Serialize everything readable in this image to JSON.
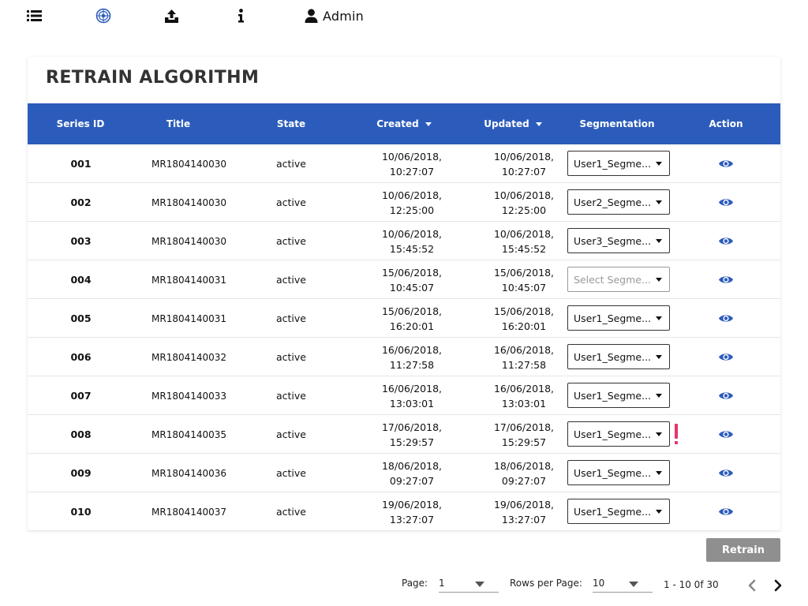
{
  "topbar": {
    "icons": [
      "list-icon",
      "globe-icon",
      "upload-icon",
      "info-icon",
      "user-icon"
    ],
    "user_label": "Admin"
  },
  "page": {
    "title": "RETRAIN ALGORITHM"
  },
  "table": {
    "columns": {
      "series_id": "Series ID",
      "title": "Title",
      "state": "State",
      "created": "Created",
      "updated": "Updated",
      "segmentation": "Segmentation",
      "action": "Action"
    },
    "rows": [
      {
        "id": "001",
        "title": "MR1804140030",
        "state": "active",
        "created_date": "10/06/2018,",
        "created_time": "10:27:07",
        "updated_date": "10/06/2018,",
        "updated_time": "10:27:07",
        "segmentation": "User1_Segme..."
      },
      {
        "id": "002",
        "title": "MR1804140030",
        "state": "active",
        "created_date": "10/06/2018,",
        "created_time": "12:25:00",
        "updated_date": "10/06/2018,",
        "updated_time": "12:25:00",
        "segmentation": "User2_Segme..."
      },
      {
        "id": "003",
        "title": "MR1804140030",
        "state": "active",
        "created_date": "10/06/2018,",
        "created_time": "15:45:52",
        "updated_date": "10/06/2018,",
        "updated_time": "15:45:52",
        "segmentation": "User3_Segme..."
      },
      {
        "id": "004",
        "title": "MR1804140031",
        "state": "active",
        "created_date": "15/06/2018,",
        "created_time": "10:45:07",
        "updated_date": "15/06/2018,",
        "updated_time": "10:45:07",
        "segmentation": "Select Segme..."
      },
      {
        "id": "005",
        "title": "MR1804140031",
        "state": "active",
        "created_date": "15/06/2018,",
        "created_time": "16:20:01",
        "updated_date": "15/06/2018,",
        "updated_time": "16:20:01",
        "segmentation": "User1_Segme..."
      },
      {
        "id": "006",
        "title": "MR1804140032",
        "state": "active",
        "created_date": "16/06/2018,",
        "created_time": "11:27:58",
        "updated_date": "16/06/2018,",
        "updated_time": "11:27:58",
        "segmentation": "User1_Segme..."
      },
      {
        "id": "007",
        "title": "MR1804140033",
        "state": "active",
        "created_date": "16/06/2018,",
        "created_time": "13:03:01",
        "updated_date": "16/06/2018,",
        "updated_time": "13:03:01",
        "segmentation": "User1_Segme..."
      },
      {
        "id": "008",
        "title": "MR1804140035",
        "state": "active",
        "created_date": "17/06/2018,",
        "created_time": "15:29:57",
        "updated_date": "17/06/2018,",
        "updated_time": "15:29:57",
        "segmentation": "User1_Segme...",
        "warning": true
      },
      {
        "id": "009",
        "title": "MR1804140036",
        "state": "active",
        "created_date": "18/06/2018,",
        "created_time": "09:27:07",
        "updated_date": "18/06/2018,",
        "updated_time": "09:27:07",
        "segmentation": "User1_Segme..."
      },
      {
        "id": "010",
        "title": "MR1804140037",
        "state": "active",
        "created_date": "19/06/2018,",
        "created_time": "13:27:07",
        "updated_date": "19/06/2018,",
        "updated_time": "13:27:07",
        "segmentation": "User1_Segme..."
      }
    ]
  },
  "actions": {
    "retrain_label": "Retrain"
  },
  "pagination": {
    "page_label": "Page:",
    "page_value": "1",
    "rows_label": "Rows per Page:",
    "rows_value": "10",
    "range_text": "1 - 10 0f 30"
  },
  "colors": {
    "header_bg": "#2c5cbb",
    "eye_icon": "#2c5cbb",
    "warning": "#e8336b",
    "retrain_button": "#8f8f8f"
  }
}
